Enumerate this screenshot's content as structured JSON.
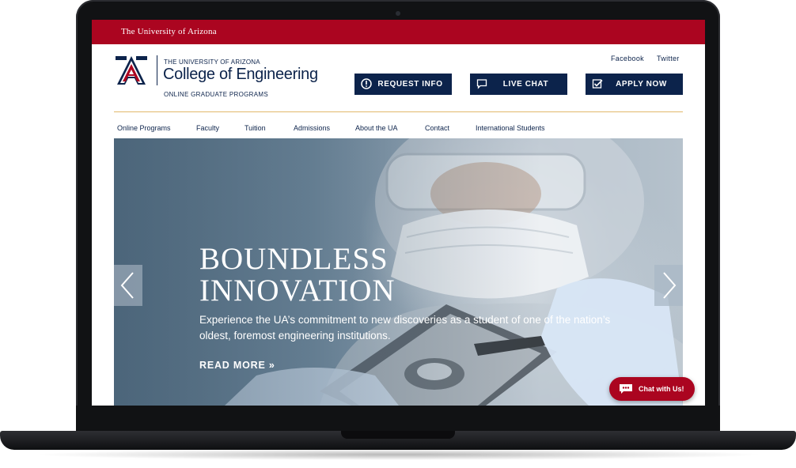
{
  "topbar": {
    "university": "The University of Arizona"
  },
  "header": {
    "uni_name": "THE UNIVERSITY OF ARIZONA",
    "college_name": "College of Engineering",
    "program_name": "ONLINE GRADUATE PROGRAMS",
    "social": [
      "Facebook",
      "Twitter"
    ],
    "cta": [
      {
        "label": "REQUEST INFO",
        "icon": "info-circle-icon"
      },
      {
        "label": "LIVE CHAT",
        "icon": "chat-icon"
      },
      {
        "label": "APPLY NOW",
        "icon": "checkbox-icon"
      }
    ]
  },
  "nav": [
    "Online Programs",
    "Faculty",
    "Tuition",
    "Admissions",
    "About the UA",
    "Contact",
    "International Students"
  ],
  "hero": {
    "title_line1": "BOUNDLESS",
    "title_line2": "INNOVATION",
    "copy": "Experience the UA’s commitment to new discoveries as a student of one of the nation’s oldest, foremost engineering institutions.",
    "link": "READ MORE »"
  },
  "chat_widget": {
    "label": "Chat with Us!",
    "icon": "chat-bubble-icon"
  },
  "colors": {
    "brand_red": "#ab0520",
    "navy": "#0c234b",
    "gold": "#e2b86b"
  }
}
